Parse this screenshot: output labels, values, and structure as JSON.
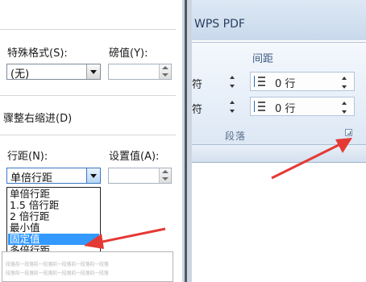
{
  "dialog": {
    "special_format_label": "特殊格式(S):",
    "measure_label": "磅值(Y):",
    "special_format_value": "(无)",
    "indent_text": "骤整右缩进(D)",
    "line_spacing_label": "行距(N):",
    "set_value_label": "设置值(A):",
    "line_spacing_value": "单倍行距",
    "options": [
      "单倍行距",
      "1.5 倍行距",
      "2 倍行距",
      "最小值",
      "固定值",
      "多倍行距"
    ],
    "selected_option": "固定值",
    "preview_lines": [
      "段落前一段落前一段落前一段落前一段落前一段落",
      "段落前一段落前一段落前一段落前一段落前一段落"
    ]
  },
  "ribbon": {
    "tab_title": "WPS PDF",
    "spacing_title": "间距",
    "row1_left_text": "符",
    "row2_left_text": "符",
    "before_spacing_value": "0 行",
    "after_spacing_value": "0 行",
    "group_label": "段落"
  },
  "colors": {
    "selection": "#3399ff",
    "arrow": "#e53935"
  }
}
